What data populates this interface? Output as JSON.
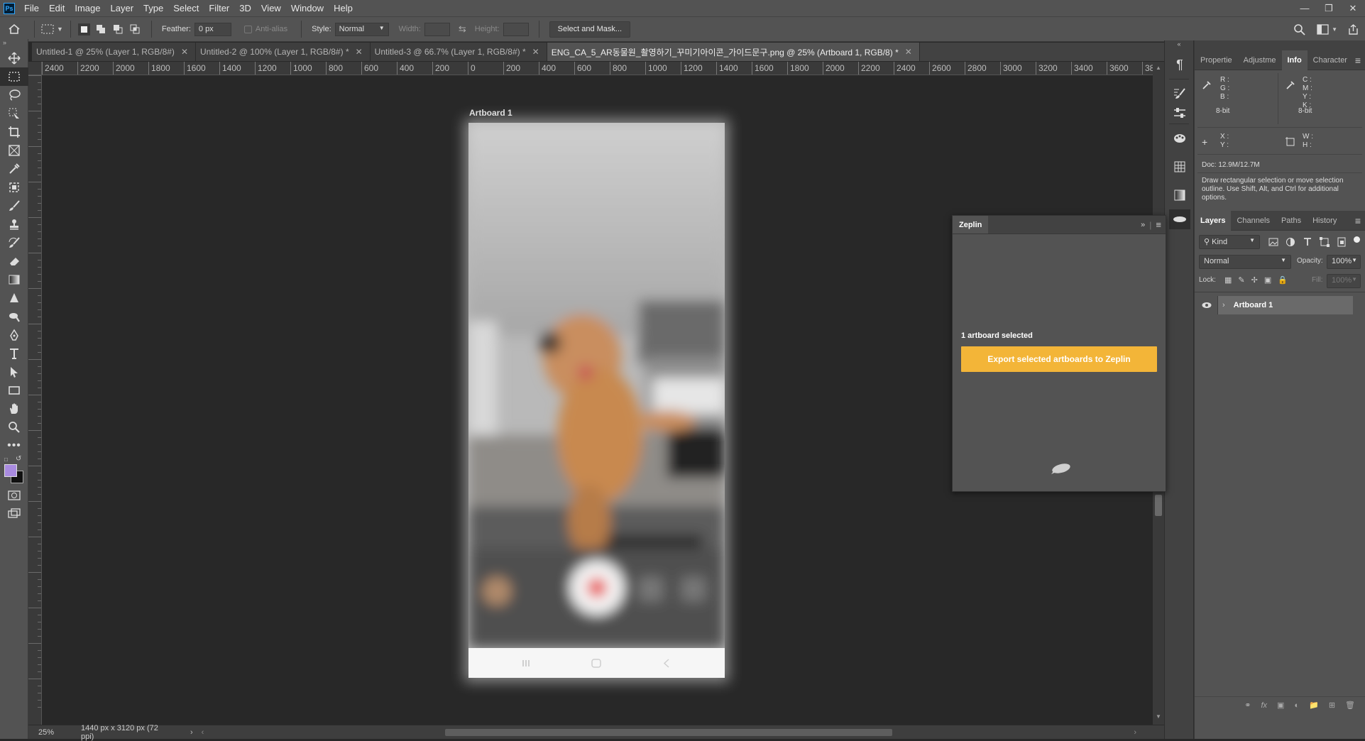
{
  "menubar": {
    "app_icon": "Ps",
    "items": [
      "File",
      "Edit",
      "Image",
      "Layer",
      "Type",
      "Select",
      "Filter",
      "3D",
      "View",
      "Window",
      "Help"
    ],
    "window_controls": [
      "minimize-icon",
      "restore-icon",
      "close-icon"
    ]
  },
  "options": {
    "feather_label": "Feather:",
    "feather_value": "0 px",
    "antialias_label": "Anti-alias",
    "style_label": "Style:",
    "style_value": "Normal",
    "width_label": "Width:",
    "height_label": "Height:",
    "select_mask": "Select and Mask..."
  },
  "tabs": [
    {
      "label": "Untitled-1 @ 25% (Layer 1, RGB/8#)",
      "active": false
    },
    {
      "label": "Untitled-2 @ 100% (Layer 1, RGB/8#) *",
      "active": false
    },
    {
      "label": "Untitled-3 @ 66.7% (Layer 1, RGB/8#) *",
      "active": false
    },
    {
      "label": "ENG_CA_5_AR동물원_촬영하기_꾸미기아이콘_가이드문구.png @ 25% (Artboard 1, RGB/8) *",
      "active": true
    }
  ],
  "ruler_h": [
    "2400",
    "2200",
    "2000",
    "1800",
    "1600",
    "1400",
    "1200",
    "1000",
    "800",
    "600",
    "400",
    "200",
    "0",
    "200",
    "400",
    "600",
    "800",
    "1000",
    "1200",
    "1400",
    "1600",
    "1800",
    "2000",
    "2200",
    "2400",
    "2600",
    "2800",
    "3000",
    "3200",
    "3400",
    "3600",
    "38"
  ],
  "canvas": {
    "artboard_title": "Artboard 1"
  },
  "status": {
    "zoom": "25%",
    "doc_size": "1440 px x 3120 px (72 ppi)"
  },
  "right_tabs_top": [
    {
      "label": "Propertie",
      "active": false
    },
    {
      "label": "Adjustme",
      "active": false
    },
    {
      "label": "Info",
      "active": true
    },
    {
      "label": "Character",
      "active": false
    }
  ],
  "info": {
    "rgb_labels": [
      "R :",
      "G :",
      "B :"
    ],
    "cmyk_labels": [
      "C :",
      "M :",
      "Y :",
      "K :"
    ],
    "bit_left": "8-bit",
    "bit_right": "8-bit",
    "xy_labels": [
      "X :",
      "Y :"
    ],
    "wh_labels": [
      "W :",
      "H :"
    ],
    "doc": "Doc: 12.9M/12.7M",
    "hint": "Draw rectangular selection or move selection outline.  Use Shift, Alt, and Ctrl for additional options."
  },
  "right_tabs_bottom": [
    {
      "label": "Layers",
      "active": true
    },
    {
      "label": "Channels",
      "active": false
    },
    {
      "label": "Paths",
      "active": false
    },
    {
      "label": "History",
      "active": false
    }
  ],
  "layers": {
    "kind": "Kind",
    "blend": "Normal",
    "opacity_label": "Opacity:",
    "opacity": "100%",
    "lock_label": "Lock:",
    "fill_label": "Fill:",
    "fill": "100%",
    "items": [
      {
        "name": "Artboard 1"
      }
    ]
  },
  "zeplin": {
    "title": "Zeplin",
    "selected_text": "1 artboard selected",
    "export_label": "Export selected artboards to Zeplin",
    "accent": "#f3b538"
  },
  "colors": {
    "foreground": "#a98be0",
    "background": "#111111"
  }
}
